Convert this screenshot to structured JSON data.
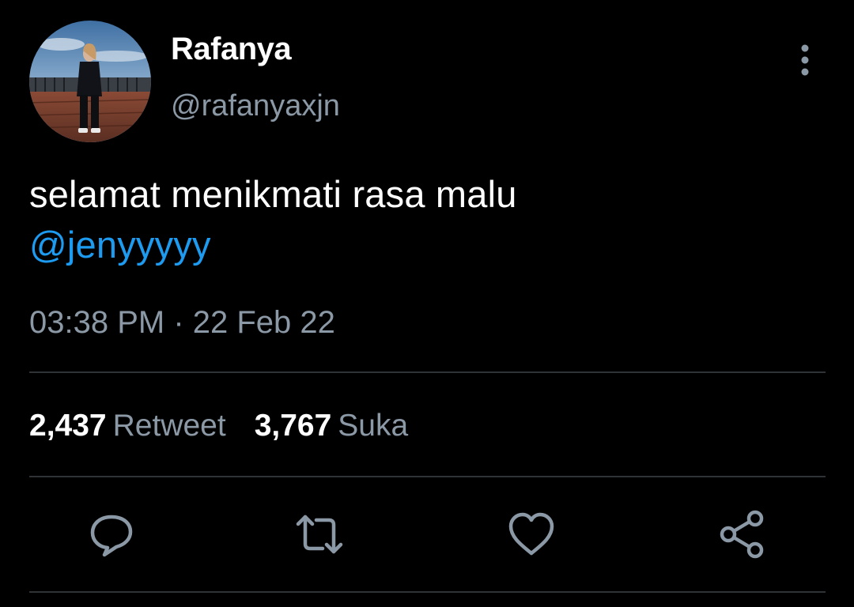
{
  "author": {
    "display_name": "Rafanya",
    "handle": "@rafanyaxjn"
  },
  "tweet": {
    "text": "selamat menikmati rasa malu",
    "mention": "@jenyyyyy",
    "timestamp": "03:38 PM · 22 Feb 22"
  },
  "stats": {
    "retweets_count": "2,437",
    "retweets_label": "Retweet",
    "likes_count": "3,767",
    "likes_label": "Suka"
  },
  "icons": {
    "more": "more-vertical-icon",
    "reply": "reply-bubble-icon",
    "retweet": "retweet-icon",
    "like": "heart-icon",
    "share": "share-icon"
  },
  "colors": {
    "background": "#000000",
    "text_primary": "#ffffff",
    "text_secondary": "#8b98a5",
    "link": "#1d9bf0",
    "divider": "#2f3336"
  }
}
